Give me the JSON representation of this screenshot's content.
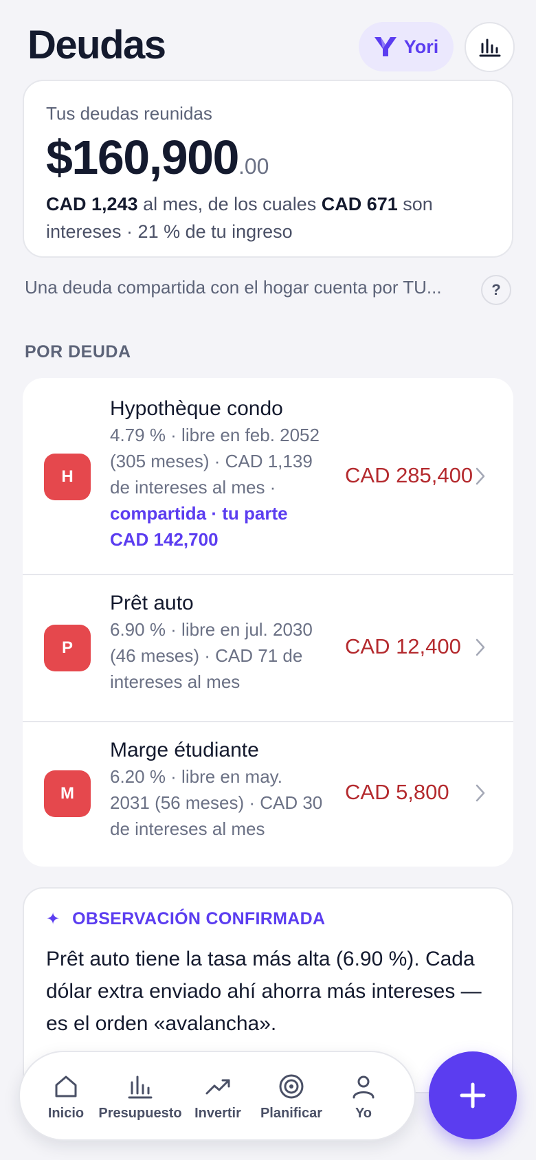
{
  "header": {
    "title": "Deudas",
    "yori_label": "Yori"
  },
  "summary": {
    "label": "Tus deudas reunidas",
    "amount_main": "$160,900",
    "amount_cents": ".00",
    "monthly_amount": "CAD 1,243",
    "monthly_text": " al mes, de los cuales ",
    "interest_amount": "CAD 671",
    "interest_text": " son intereses · 21 % de tu ingreso"
  },
  "shared_note": "Una deuda compartida con el hogar cuenta por TU...",
  "help_label": "?",
  "section_title": "POR DEUDA",
  "debts": [
    {
      "initial": "H",
      "name": "Hypothèque condo",
      "meta": "4.79 % · libre en feb. 2052 (305 meses) · CAD 1,139 de intereses al mes ·",
      "share": "compartida · tu parte CAD 142,700",
      "amount": "CAD 285,400"
    },
    {
      "initial": "P",
      "name": "Prêt auto",
      "meta": "6.90 % · libre en jul. 2030 (46 meses) · CAD 71 de intereses al mes",
      "amount": "CAD 12,400"
    },
    {
      "initial": "M",
      "name": "Marge étudiante",
      "meta": "6.20 % · libre en may. 2031 (56 meses) · CAD 30 de intereses al mes",
      "amount": "CAD 5,800"
    }
  ],
  "observation": {
    "title": "OBSERVACIÓN CONFIRMADA",
    "text": "Prêt auto tiene la tasa más alta (6.90 %). Cada dólar extra enviado ahí ahorra más intereses — es el orden «avalancha»."
  },
  "nav": [
    {
      "label": "Inicio",
      "icon": "home-icon"
    },
    {
      "label": "Presupuesto",
      "icon": "bar-chart-icon"
    },
    {
      "label": "Invertir",
      "icon": "trend-up-icon"
    },
    {
      "label": "Planificar",
      "icon": "target-icon"
    },
    {
      "label": "Yo",
      "icon": "user-icon"
    }
  ],
  "colors": {
    "accent": "#5b3df0",
    "debt_red": "#b42a2e",
    "avatar_red": "#e5484d",
    "background": "#f4f4f8"
  }
}
